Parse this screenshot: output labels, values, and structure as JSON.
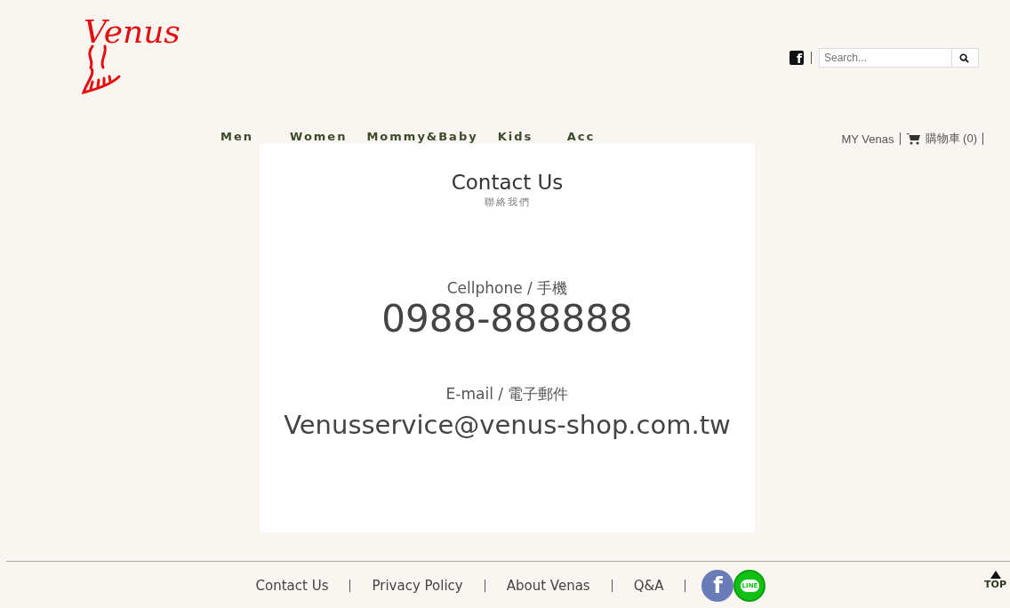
{
  "logo": {
    "text": "Venus"
  },
  "header": {
    "facebook_glyph": "f",
    "search": {
      "placeholder": "Search..."
    }
  },
  "nav": [
    "Men",
    "Women",
    "Mommy&Baby",
    "Kids",
    "Acc"
  ],
  "account": {
    "my_link": "MY Venas",
    "cart": "購物車 (0)"
  },
  "contact": {
    "title": "Contact Us",
    "subtitle": "聯絡我們",
    "items": [
      {
        "label": "Cellphone / 手機",
        "value": "0988-888888",
        "kind": "phone"
      },
      {
        "label": "E-mail / 電子郵件",
        "value": "Venusservice@venus-shop.com.tw",
        "kind": "email"
      }
    ]
  },
  "footer": {
    "links": [
      "Contact Us",
      "Privacy Policy",
      "About Venas",
      "Q&A"
    ],
    "facebook_glyph": "f",
    "line_glyph": "LINE",
    "top": "TOP"
  }
}
